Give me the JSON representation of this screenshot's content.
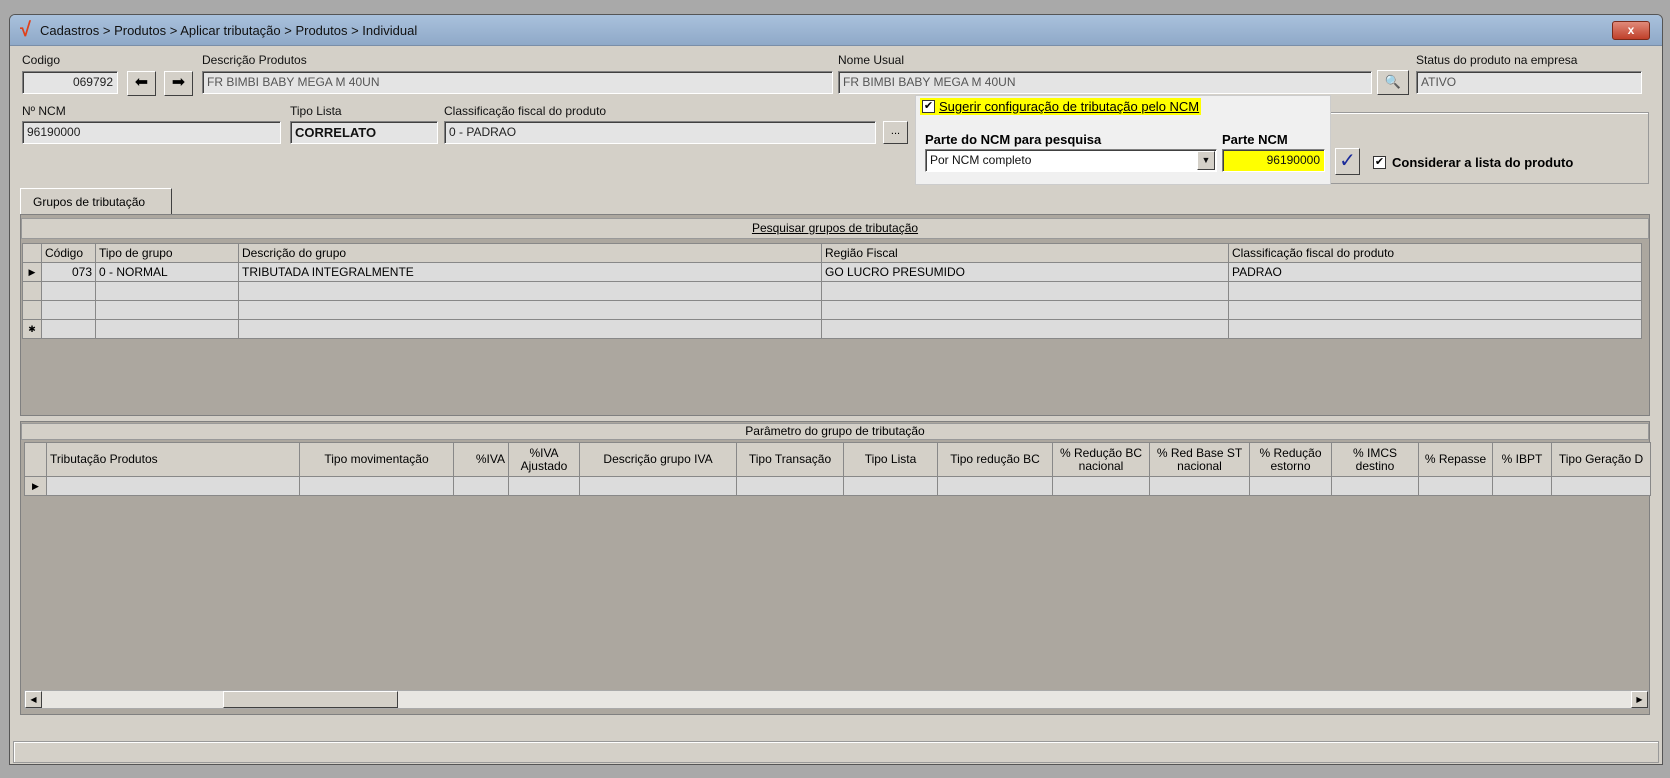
{
  "window": {
    "title": "Cadastros > Produtos > Aplicar tributação > Produtos > Individual",
    "close": "x"
  },
  "form": {
    "codigo_label": "Codigo",
    "codigo": "069792",
    "descricao_label": "Descrição  Produtos",
    "descricao": "FR BIMBI BABY MEGA M 40UN",
    "nome_usual_label": "Nome Usual",
    "nome_usual": "FR BIMBI BABY MEGA M 40UN",
    "status_label": "Status do produto na empresa",
    "status": "ATIVO",
    "ncm_label": "Nº NCM",
    "ncm": "96190000",
    "tipo_lista_label": "Tipo Lista",
    "tipo_lista": "CORRELATO",
    "classif_label": "Classificação fiscal do produto",
    "classif": "0 - PADRAO",
    "ellipsis": "..."
  },
  "ncm_panel": {
    "suggest_label": "Sugerir configuração de tributação pelo NCM",
    "parte_label": "Parte do NCM para pesquisa",
    "parte_value": "Por NCM completo",
    "parte_ncm_label": "Parte NCM",
    "parte_ncm": "96190000",
    "considerar_label": "Considerar a lista do produto"
  },
  "tab": "Grupos de tributação",
  "grid1": {
    "title": "Pesquisar grupos de tributação",
    "columns": [
      "Código",
      "Tipo de grupo",
      "Descrição do grupo",
      "Região Fiscal",
      "Classificação fiscal do produto"
    ],
    "rows": [
      [
        "073",
        "0 - NORMAL",
        "TRIBUTADA INTEGRALMENTE",
        "GO LUCRO PRESUMIDO",
        "PADRAO"
      ]
    ]
  },
  "grid2": {
    "title": "Parâmetro do grupo de tributação",
    "columns": [
      "Tributação Produtos",
      "Tipo movimentação",
      "%IVA",
      "%IVA Ajustado",
      "Descrição grupo IVA",
      "Tipo Transação",
      "Tipo Lista",
      "Tipo redução BC",
      "% Redução BC nacional",
      "% Red Base ST nacional",
      "% Redução estorno",
      "% IMCS destino",
      "% Repasse",
      "% IBPT",
      "Tipo Geração D"
    ]
  }
}
